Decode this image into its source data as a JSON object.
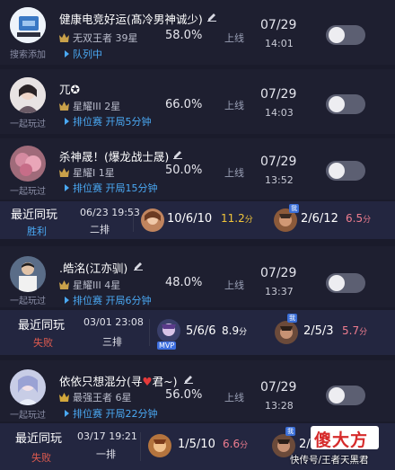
{
  "rows": [
    {
      "name": "健康电竞好运(髙冷男神诚少)",
      "sub": "搜索添加",
      "rank": "无双王者 39星",
      "status": "队列中",
      "winrate": "58.0%",
      "online": "上线",
      "date": "07/29",
      "time": "14:01"
    },
    {
      "name": "兀✪",
      "sub": "一起玩过",
      "rank": "星耀III 2星",
      "status": "排位赛 开局5分钟",
      "winrate": "66.0%",
      "online": "上线",
      "date": "07/29",
      "time": "14:03"
    },
    {
      "name": "杀神晟！(爆龙战士晟)",
      "sub": "一起玩过",
      "rank": "星耀I 1星",
      "status": "排位赛 开局15分钟",
      "winrate": "50.0%",
      "online": "上线",
      "date": "07/29",
      "time": "13:52"
    },
    {
      "name": ".皓洺(江亦驯)",
      "sub": "一起玩过",
      "rank": "星耀III 4星",
      "status": "排位赛 开局6分钟",
      "winrate": "48.0%",
      "online": "上线",
      "date": "07/29",
      "time": "13:37"
    },
    {
      "name_pre": "依依只想混分(寻",
      "name_heart": "♥",
      "name_post": "君~)",
      "sub": "一起玩过",
      "rank": "最强王者 6星",
      "status": "排位赛 开局22分钟",
      "winrate": "56.0%",
      "online": "上线",
      "date": "07/29",
      "time": "13:28"
    }
  ],
  "recent": [
    {
      "title": "最近同玩",
      "result": "胜利",
      "date": "06/23 19:53",
      "mode": "二排",
      "my_kda": "10/6/10",
      "my_score": "11.2",
      "their_kda": "2/6/12",
      "their_score": "6.5",
      "unit": "分"
    },
    {
      "title": "最近同玩",
      "result": "失败",
      "date": "03/01 23:08",
      "mode": "三排",
      "my_kda": "5/6/6",
      "my_score": "8.9",
      "their_kda": "2/5/3",
      "their_score": "5.7",
      "unit": "分",
      "badge_mvp": "MVP",
      "badge_me": "我"
    },
    {
      "title": "最近同玩",
      "result": "失败",
      "date": "03/17 19:21",
      "mode": "一排",
      "my_kda": "1/5/10",
      "my_score": "6.6",
      "their_kda": "2/8",
      "unit": "分",
      "badge_me": "我"
    }
  ],
  "watermark": {
    "brand": "傻大方",
    "caption": "快传号/王者天黑君"
  },
  "colors": {
    "accent_blue": "#4aa9f4",
    "win": "#4aa9f4",
    "lose": "#e05b4f",
    "gold": "#f1c53a",
    "pink": "#ef7d8f"
  }
}
